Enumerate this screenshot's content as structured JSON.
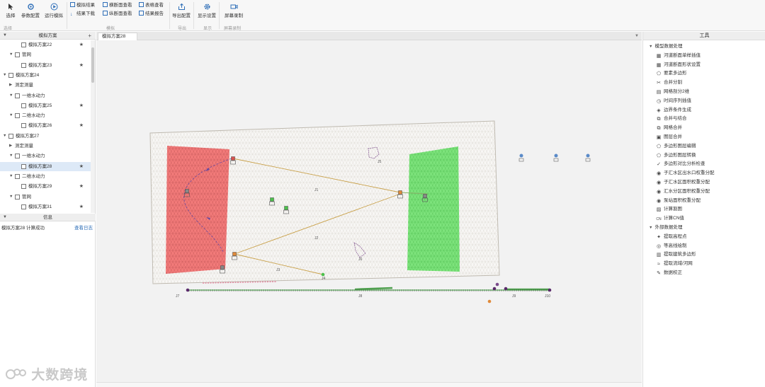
{
  "ribbon": {
    "buttons": {
      "select": "选择",
      "params": "参数配置",
      "run": "运行模拟",
      "export": "导出配置",
      "display": "显示设置",
      "record": "屏幕录制"
    },
    "small": {
      "sim_result": "模拟结果",
      "result_download": "结果下载",
      "cross_section": "横断面查看",
      "long_section": "纵断面查看",
      "table_view": "表格查看",
      "result_report": "结果报告"
    },
    "groups": {
      "g1": "选择",
      "g2": "模拟",
      "g3": "导出",
      "g4": "显示",
      "g5": "屏幕录制"
    }
  },
  "left_panel": {
    "title": "模拟方案",
    "add": "+",
    "tree": [
      {
        "label": "模拟方案22",
        "indent": 2,
        "checkbox": true,
        "star": "★",
        "twist": ""
      },
      {
        "label": "管网",
        "indent": 1,
        "checkbox": true,
        "star": "",
        "twist": "▼"
      },
      {
        "label": "模拟方案23",
        "indent": 2,
        "checkbox": true,
        "star": "★",
        "twist": ""
      },
      {
        "label": "模拟方案24",
        "indent": 0,
        "checkbox": true,
        "star": "",
        "twist": "▼"
      },
      {
        "label": "测定测量",
        "indent": 1,
        "checkbox": false,
        "star": "",
        "twist": "▶"
      },
      {
        "label": "一维水动力",
        "indent": 1,
        "checkbox": true,
        "star": "",
        "twist": "▼"
      },
      {
        "label": "模拟方案25",
        "indent": 2,
        "checkbox": true,
        "star": "★",
        "twist": ""
      },
      {
        "label": "二维水动力",
        "indent": 1,
        "checkbox": true,
        "star": "",
        "twist": "▼"
      },
      {
        "label": "模拟方案26",
        "indent": 2,
        "checkbox": true,
        "star": "★",
        "twist": ""
      },
      {
        "label": "模拟方案27",
        "indent": 0,
        "checkbox": true,
        "star": "",
        "twist": "▼"
      },
      {
        "label": "测定测量",
        "indent": 1,
        "checkbox": false,
        "star": "",
        "twist": "▶"
      },
      {
        "label": "一维水动力",
        "indent": 1,
        "checkbox": true,
        "star": "",
        "twist": "▼"
      },
      {
        "label": "模拟方案28",
        "indent": 2,
        "checkbox": true,
        "star": "★",
        "twist": "",
        "selected": true
      },
      {
        "label": "二维水动力",
        "indent": 1,
        "checkbox": true,
        "star": "",
        "twist": "▼"
      },
      {
        "label": "模拟方案29",
        "indent": 2,
        "checkbox": true,
        "star": "★",
        "twist": ""
      },
      {
        "label": "管网",
        "indent": 1,
        "checkbox": true,
        "star": "",
        "twist": "▼"
      },
      {
        "label": "模拟方案31",
        "indent": 2,
        "checkbox": true,
        "star": "★",
        "twist": ""
      }
    ],
    "log_title": "信息",
    "log_message": "模拟方案28 计算成功",
    "log_link": "查看日志",
    "watermark": "大数跨境"
  },
  "center": {
    "tab": "模拟方案28",
    "node_labels": [
      "J1",
      "J2",
      "J3",
      "J4",
      "J5",
      "J6",
      "J7",
      "J8",
      "J9",
      "J10"
    ]
  },
  "right_panel": {
    "title": "工具",
    "sections": [
      {
        "title": "模型数据处理",
        "items": [
          {
            "label": "河道断面单样插值",
            "icon": "chart-icon"
          },
          {
            "label": "河道断面形状设置",
            "icon": "chart-icon"
          },
          {
            "label": "要素多边形",
            "icon": "polygon-icon"
          },
          {
            "label": "合并分割",
            "icon": "split-icon"
          },
          {
            "label": "网格剖分2维",
            "icon": "grid-icon"
          },
          {
            "label": "时间序列插值",
            "icon": "clock-icon"
          },
          {
            "label": "边界条件生成",
            "icon": "edge-icon"
          },
          {
            "label": "合并与结合",
            "icon": "merge-icon"
          },
          {
            "label": "网格合并",
            "icon": "merge-icon"
          },
          {
            "label": "图层合并",
            "icon": "layer-icon"
          },
          {
            "label": "多边形图层编辑",
            "icon": "polygon-icon"
          },
          {
            "label": "多边形图层转换",
            "icon": "polygon-icon"
          },
          {
            "label": "多边形对比分析检查",
            "icon": "check-icon"
          },
          {
            "label": "子汇水区出水口权重分配",
            "icon": "node-icon"
          },
          {
            "label": "子汇水区面积权重分配",
            "icon": "node-icon"
          },
          {
            "label": "汇水分区面积权重分配",
            "icon": "node-icon"
          },
          {
            "label": "泵站面积权重分配",
            "icon": "node-icon"
          },
          {
            "label": "计算割图",
            "icon": "calc-icon"
          },
          {
            "label": "计算CN值",
            "icon": "cn-icon"
          }
        ]
      },
      {
        "title": "外部数据处理",
        "items": [
          {
            "label": "提取高程点",
            "icon": "point-icon"
          },
          {
            "label": "等高线绘制",
            "icon": "contour-icon"
          },
          {
            "label": "提取建筑多边形",
            "icon": "building-icon"
          },
          {
            "label": "提取流域/河网",
            "icon": "river-icon"
          },
          {
            "label": "数据校正",
            "icon": "fix-icon"
          }
        ]
      }
    ]
  },
  "colors": {
    "accent": "#2f6fb8",
    "inflow_zone": "#f26d6d",
    "outflow_zone": "#6fe06f",
    "link": "#c9a14a",
    "mesh": "#d7d3cc",
    "river": "#7bc47b"
  }
}
